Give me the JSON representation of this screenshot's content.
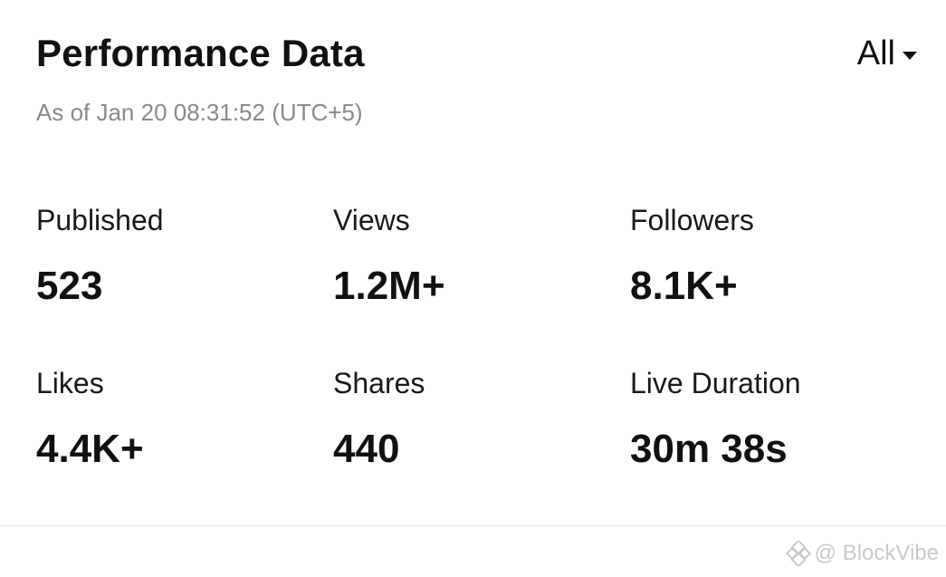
{
  "header": {
    "title": "Performance Data",
    "filter_label": "All",
    "timestamp": "As of Jan 20 08:31:52 (UTC+5)"
  },
  "stats": [
    {
      "label": "Published",
      "value": "523"
    },
    {
      "label": "Views",
      "value": "1.2M+"
    },
    {
      "label": "Followers",
      "value": "8.1K+"
    },
    {
      "label": "Likes",
      "value": "4.4K+"
    },
    {
      "label": "Shares",
      "value": "440"
    },
    {
      "label": "Live Duration",
      "value": "30m 38s"
    }
  ],
  "watermark": {
    "text": "@ BlockVibe",
    "icon": "diamond-logo-icon"
  },
  "colors": {
    "text_primary": "#111111",
    "text_secondary": "#8a8a8a",
    "divider": "#e3e3e3",
    "watermark": "#c9c9c9"
  }
}
